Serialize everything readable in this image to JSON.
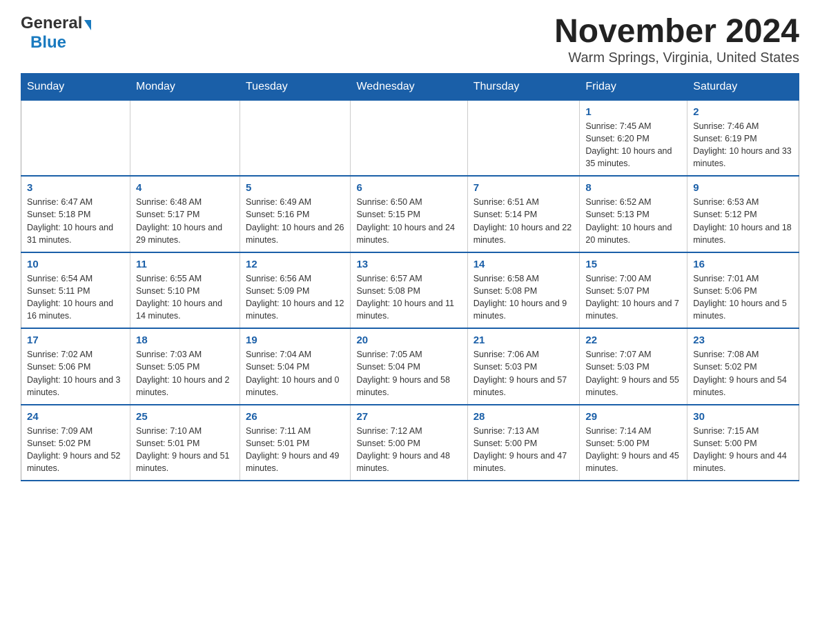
{
  "logo": {
    "general": "General",
    "blue": "Blue",
    "line1": "General"
  },
  "title": "November 2024",
  "subtitle": "Warm Springs, Virginia, United States",
  "days_header": [
    "Sunday",
    "Monday",
    "Tuesday",
    "Wednesday",
    "Thursday",
    "Friday",
    "Saturday"
  ],
  "weeks": [
    [
      {
        "day": "",
        "info": ""
      },
      {
        "day": "",
        "info": ""
      },
      {
        "day": "",
        "info": ""
      },
      {
        "day": "",
        "info": ""
      },
      {
        "day": "",
        "info": ""
      },
      {
        "day": "1",
        "info": "Sunrise: 7:45 AM\nSunset: 6:20 PM\nDaylight: 10 hours and 35 minutes."
      },
      {
        "day": "2",
        "info": "Sunrise: 7:46 AM\nSunset: 6:19 PM\nDaylight: 10 hours and 33 minutes."
      }
    ],
    [
      {
        "day": "3",
        "info": "Sunrise: 6:47 AM\nSunset: 5:18 PM\nDaylight: 10 hours and 31 minutes."
      },
      {
        "day": "4",
        "info": "Sunrise: 6:48 AM\nSunset: 5:17 PM\nDaylight: 10 hours and 29 minutes."
      },
      {
        "day": "5",
        "info": "Sunrise: 6:49 AM\nSunset: 5:16 PM\nDaylight: 10 hours and 26 minutes."
      },
      {
        "day": "6",
        "info": "Sunrise: 6:50 AM\nSunset: 5:15 PM\nDaylight: 10 hours and 24 minutes."
      },
      {
        "day": "7",
        "info": "Sunrise: 6:51 AM\nSunset: 5:14 PM\nDaylight: 10 hours and 22 minutes."
      },
      {
        "day": "8",
        "info": "Sunrise: 6:52 AM\nSunset: 5:13 PM\nDaylight: 10 hours and 20 minutes."
      },
      {
        "day": "9",
        "info": "Sunrise: 6:53 AM\nSunset: 5:12 PM\nDaylight: 10 hours and 18 minutes."
      }
    ],
    [
      {
        "day": "10",
        "info": "Sunrise: 6:54 AM\nSunset: 5:11 PM\nDaylight: 10 hours and 16 minutes."
      },
      {
        "day": "11",
        "info": "Sunrise: 6:55 AM\nSunset: 5:10 PM\nDaylight: 10 hours and 14 minutes."
      },
      {
        "day": "12",
        "info": "Sunrise: 6:56 AM\nSunset: 5:09 PM\nDaylight: 10 hours and 12 minutes."
      },
      {
        "day": "13",
        "info": "Sunrise: 6:57 AM\nSunset: 5:08 PM\nDaylight: 10 hours and 11 minutes."
      },
      {
        "day": "14",
        "info": "Sunrise: 6:58 AM\nSunset: 5:08 PM\nDaylight: 10 hours and 9 minutes."
      },
      {
        "day": "15",
        "info": "Sunrise: 7:00 AM\nSunset: 5:07 PM\nDaylight: 10 hours and 7 minutes."
      },
      {
        "day": "16",
        "info": "Sunrise: 7:01 AM\nSunset: 5:06 PM\nDaylight: 10 hours and 5 minutes."
      }
    ],
    [
      {
        "day": "17",
        "info": "Sunrise: 7:02 AM\nSunset: 5:06 PM\nDaylight: 10 hours and 3 minutes."
      },
      {
        "day": "18",
        "info": "Sunrise: 7:03 AM\nSunset: 5:05 PM\nDaylight: 10 hours and 2 minutes."
      },
      {
        "day": "19",
        "info": "Sunrise: 7:04 AM\nSunset: 5:04 PM\nDaylight: 10 hours and 0 minutes."
      },
      {
        "day": "20",
        "info": "Sunrise: 7:05 AM\nSunset: 5:04 PM\nDaylight: 9 hours and 58 minutes."
      },
      {
        "day": "21",
        "info": "Sunrise: 7:06 AM\nSunset: 5:03 PM\nDaylight: 9 hours and 57 minutes."
      },
      {
        "day": "22",
        "info": "Sunrise: 7:07 AM\nSunset: 5:03 PM\nDaylight: 9 hours and 55 minutes."
      },
      {
        "day": "23",
        "info": "Sunrise: 7:08 AM\nSunset: 5:02 PM\nDaylight: 9 hours and 54 minutes."
      }
    ],
    [
      {
        "day": "24",
        "info": "Sunrise: 7:09 AM\nSunset: 5:02 PM\nDaylight: 9 hours and 52 minutes."
      },
      {
        "day": "25",
        "info": "Sunrise: 7:10 AM\nSunset: 5:01 PM\nDaylight: 9 hours and 51 minutes."
      },
      {
        "day": "26",
        "info": "Sunrise: 7:11 AM\nSunset: 5:01 PM\nDaylight: 9 hours and 49 minutes."
      },
      {
        "day": "27",
        "info": "Sunrise: 7:12 AM\nSunset: 5:00 PM\nDaylight: 9 hours and 48 minutes."
      },
      {
        "day": "28",
        "info": "Sunrise: 7:13 AM\nSunset: 5:00 PM\nDaylight: 9 hours and 47 minutes."
      },
      {
        "day": "29",
        "info": "Sunrise: 7:14 AM\nSunset: 5:00 PM\nDaylight: 9 hours and 45 minutes."
      },
      {
        "day": "30",
        "info": "Sunrise: 7:15 AM\nSunset: 5:00 PM\nDaylight: 9 hours and 44 minutes."
      }
    ]
  ]
}
